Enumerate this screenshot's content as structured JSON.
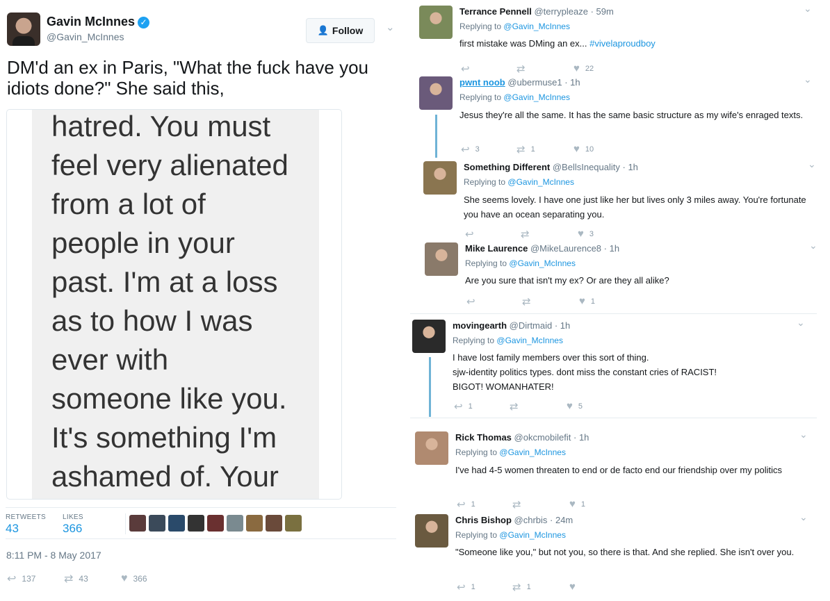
{
  "main_tweet": {
    "name": "Gavin McInnes",
    "handle": "@Gavin_McInnes",
    "follow_label": "Follow",
    "text": "DM'd an ex in Paris, \"What the fuck have you idiots done?\" She said this,",
    "screenshot_lines": [
      "hatred. You must",
      "feel very alienated",
      "from a lot of",
      "people in your",
      "past. I'm at a loss",
      "as to how I was",
      "ever with",
      "someone like you.",
      "It's something I'm",
      "ashamed of. Your"
    ],
    "retweets_label": "RETWEETS",
    "retweets": "43",
    "likes_label": "LIKES",
    "likes": "366",
    "timestamp": "8:11 PM - 8 May 2017",
    "actions": {
      "reply": "137",
      "retweet": "43",
      "like": "366"
    },
    "liker_colors": [
      "#5a3b3b",
      "#3b4a5a",
      "#2a4a6a",
      "#333333",
      "#6a3030",
      "#7a8a90",
      "#8a6a40",
      "#6a4a3a",
      "#7a7040"
    ]
  },
  "replying_prefix": "Replying to",
  "replies": [
    {
      "name": "Terrance Pennell",
      "handle": "@terrypleaze",
      "time": "59m",
      "replying_to": "@Gavin_McInnes",
      "text": "first mistake was DMing an ex... ",
      "hashtag": "#vivelaproudboy",
      "reply_count": "",
      "retweet_count": "",
      "like_count": "22",
      "avatar_color": "#7a8a5a"
    },
    {
      "name": "pwnt noob",
      "handle": "@ubermuse1",
      "time": "1h",
      "replying_to": "@Gavin_McInnes",
      "text": "Jesus they're all the same. It has the same basic structure as my wife's enraged texts.",
      "reply_count": "3",
      "retweet_count": "1",
      "like_count": "10",
      "avatar_color": "#6a5a7a"
    },
    {
      "name": "Something Different",
      "handle": "@BellsInequality",
      "time": "1h",
      "replying_to": "@Gavin_McInnes",
      "text": "She seems lovely. I have one just like her but lives only 3 miles away. You're fortunate you have an ocean separating you.",
      "reply_count": "",
      "retweet_count": "",
      "like_count": "3",
      "avatar_color": "#8a7550"
    },
    {
      "name": "Mike Laurence",
      "handle": "@MikeLaurence8",
      "time": "1h",
      "replying_to": "@Gavin_McInnes",
      "text": "Are you sure that isn't my ex? Or are they all alike?",
      "reply_count": "",
      "retweet_count": "",
      "like_count": "1",
      "avatar_color": "#8a7a6a"
    },
    {
      "name": "movingearth",
      "handle": "@Dirtmaid",
      "time": "1h",
      "replying_to": "@Gavin_McInnes",
      "text_lines": [
        "I have lost family members over this sort of thing.",
        "sjw-identity politics types. dont miss the constant cries of RACIST!",
        "BIGOT! WOMANHATER!"
      ],
      "reply_count": "1",
      "retweet_count": "",
      "like_count": "5",
      "avatar_color": "#2a2a2a"
    },
    {
      "name": "Rick Thomas",
      "handle": "@okcmobilefit",
      "time": "1h",
      "replying_to": "@Gavin_McInnes",
      "text": "I've had 4-5 women threaten to end or de facto end our friendship over my politics",
      "reply_count": "1",
      "retweet_count": "",
      "like_count": "1",
      "avatar_color": "#b08a70"
    },
    {
      "name": "Chris Bishop",
      "handle": "@chrbis",
      "time": "24m",
      "replying_to": "@Gavin_McInnes",
      "text": "\"Someone like you,\" but not you, so there is that. And she replied. She isn't over you.",
      "reply_count": "1",
      "retweet_count": "1",
      "like_count": "",
      "avatar_color": "#6a5a40"
    }
  ]
}
